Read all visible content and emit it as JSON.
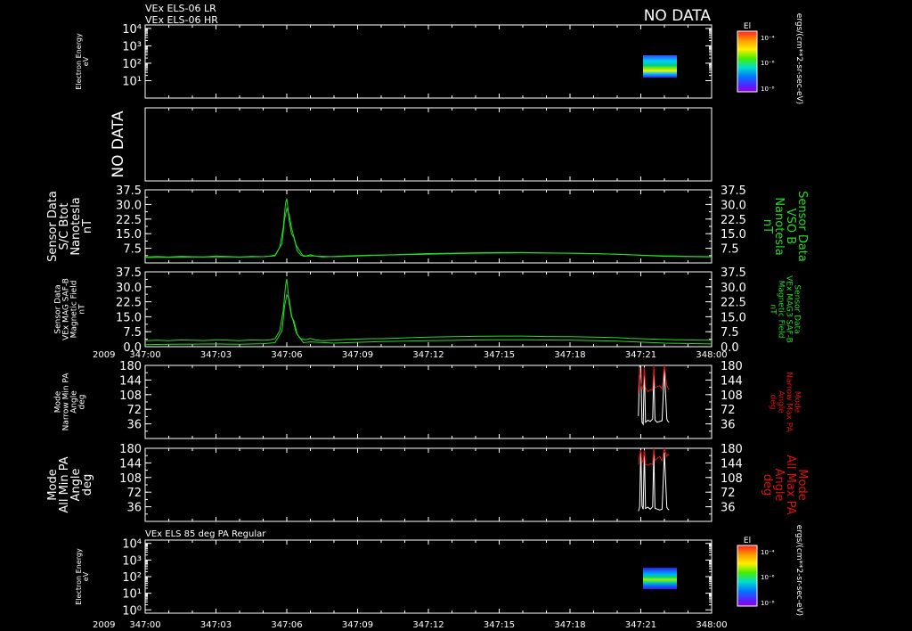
{
  "header": {
    "line1": "VEx ELS-06 LR",
    "line2": "VEx ELS-06 HR",
    "no_data": "NO DATA"
  },
  "panel7_title": "VEx ELS 85 deg PA Regular",
  "colors": {
    "background": "#000000",
    "axes": "#ffffff",
    "green": "#22dd22",
    "red": "#dd1111",
    "white": "#ffffff"
  },
  "colorbars": [
    {
      "title": "El",
      "units": "ergs/(cm**2-sr-sec-eV)",
      "tick_labels": [
        "10⁻⁴",
        "10⁻⁶",
        "10⁻⁸"
      ]
    },
    {
      "title": "El",
      "units": "ergs/(cm**2-sr-sec-eV)",
      "tick_labels": [
        "10⁻⁴",
        "10⁻⁶",
        "10⁻⁸"
      ]
    }
  ],
  "x_axis": {
    "year": "2009",
    "tick_labels": [
      "347:00",
      "347:03",
      "347:06",
      "347:09",
      "347:12",
      "347:15",
      "347:18",
      "347:21",
      "348:00"
    ],
    "domain_minutes": [
      0,
      24
    ]
  },
  "chart_data": [
    {
      "type": "heatmap",
      "ylabel": "Electron Energy\neV",
      "y_tick_labels": [
        "10⁴",
        "10³",
        "10²",
        "10¹"
      ],
      "ylim_log": [
        0,
        4.2
      ],
      "data_x_range_minutes": [
        20.9,
        22.2
      ],
      "data_energy_range_log": [
        1.0,
        2.4
      ]
    },
    {
      "type": "table",
      "ylabel": "NO DATA"
    },
    {
      "type": "line",
      "ylabel": "Sensor Data\nS/C Btot\nNanotesla\nnT",
      "right_label": "Sensor Data\nVSO B\nNanotesla\nnT",
      "y_tick_labels": [
        "37.5",
        "30.0",
        "22.5",
        "15.0",
        "7.5"
      ],
      "ylim": [
        0,
        37.5
      ],
      "series": [
        {
          "color": "green",
          "x": [
            0,
            0.5,
            1,
            1.5,
            2,
            2.5,
            3,
            3.5,
            4,
            4.5,
            5,
            5.3,
            5.5,
            5.7,
            5.85,
            5.95,
            6.0,
            6.05,
            6.1,
            6.2,
            6.3,
            6.45,
            6.6,
            6.8,
            7.0,
            7.2,
            7.5,
            8,
            8.5,
            9,
            9.5,
            10,
            11,
            12,
            13,
            14,
            15,
            16,
            17,
            18,
            19,
            20,
            20.5,
            21,
            21.5,
            22,
            22.5,
            23,
            23.5,
            24
          ],
          "y": [
            3,
            3.3,
            3,
            3.4,
            3.2,
            3.1,
            3.5,
            3.3,
            3,
            3.4,
            3.2,
            3.5,
            4,
            8,
            18,
            31,
            33,
            28,
            22,
            15,
            13,
            6,
            4,
            3.5,
            4.2,
            3.5,
            3,
            3.3,
            3.6,
            3.8,
            4,
            4,
            4.4,
            4.8,
            5,
            5.2,
            5.3,
            5.3,
            5.1,
            5,
            4.8,
            4.5,
            4.2,
            4,
            3.8,
            3.6,
            3.5,
            3.4,
            3.3,
            3.2
          ]
        },
        {
          "color": "green",
          "x": [
            0,
            1,
            2,
            3,
            4,
            5,
            5.5,
            5.8,
            5.9,
            6.0,
            6.1,
            6.2,
            6.4,
            6.7,
            7,
            8,
            9,
            10,
            12,
            14,
            16,
            18,
            20,
            22,
            24
          ],
          "y": [
            2.8,
            2.9,
            3,
            3.1,
            3,
            3.2,
            3.6,
            10,
            22,
            28,
            25,
            18,
            9,
            3.4,
            3.6,
            3.2,
            3.5,
            4,
            4.5,
            5,
            5.1,
            5,
            4.5,
            3.4,
            3.1
          ]
        }
      ]
    },
    {
      "type": "line",
      "ylabel": "Sensor Data\nVEx MAG SAF-B\nMagnetic Field\nnT",
      "right_label": "Sensor Data\nVEx MAG3 SAF-B\nMagnetic Field\nnT",
      "y_tick_labels": [
        "37.5",
        "30.0",
        "22.5",
        "15.0",
        "7.5",
        "0.0"
      ],
      "ylim": [
        0,
        37.5
      ],
      "series": [
        {
          "color": "green",
          "x": [
            0,
            0.5,
            1,
            1.5,
            2,
            2.5,
            3,
            3.5,
            4,
            4.5,
            5,
            5.3,
            5.5,
            5.7,
            5.85,
            5.95,
            6.0,
            6.05,
            6.1,
            6.2,
            6.3,
            6.45,
            6.6,
            6.8,
            7.0,
            7.2,
            7.5,
            8,
            8.5,
            9,
            9.5,
            10,
            11,
            12,
            13,
            14,
            15,
            16,
            17,
            18,
            19,
            20,
            20.5,
            21,
            21.5,
            22,
            22.5,
            23,
            23.5,
            24
          ],
          "y": [
            3,
            3.3,
            3,
            3.4,
            3.2,
            3.1,
            3.5,
            3.3,
            3,
            3.4,
            3.2,
            3.5,
            4,
            8,
            18,
            31,
            34,
            28,
            22,
            15,
            13,
            6,
            4,
            3.5,
            4.2,
            3.5,
            3,
            3.3,
            3.6,
            3.8,
            4,
            4,
            4.4,
            4.8,
            5,
            5.2,
            5.3,
            5.3,
            5.1,
            5,
            4.8,
            4.5,
            4.2,
            4,
            3.8,
            3.6,
            3.5,
            3.4,
            3.3,
            3.2
          ]
        },
        {
          "color": "green",
          "x": [
            0,
            1,
            2,
            3,
            4,
            5,
            5.5,
            5.8,
            5.9,
            6.0,
            6.1,
            6.2,
            6.4,
            6.7,
            7,
            8,
            9,
            10,
            12,
            14,
            16,
            18,
            20,
            22,
            24
          ],
          "y": [
            1,
            1.2,
            1.3,
            1.4,
            1.2,
            1.5,
            2,
            8,
            20,
            26,
            24,
            16,
            7,
            2,
            2.4,
            1.8,
            2.2,
            2.6,
            3,
            3.4,
            3.5,
            3.3,
            2.8,
            1.8,
            1.4
          ]
        }
      ]
    },
    {
      "type": "line",
      "ylabel": "Mode\nNarrow Min PA\nAngle\ndeg",
      "right_label": "Mode\nNarrow Max PA\nAngle\ndeg",
      "y_tick_labels": [
        "180",
        "144",
        "108",
        "72",
        "36"
      ],
      "ylim": [
        0,
        180
      ],
      "series": [
        {
          "color": "white",
          "x": [
            20.9,
            20.95,
            21.0,
            21.05,
            21.1,
            21.15,
            21.2,
            21.3,
            21.4,
            21.5,
            21.55,
            21.6,
            21.7,
            21.8,
            21.9,
            22.0,
            22.1,
            22.15,
            22.2
          ],
          "y": [
            55,
            180,
            180,
            40,
            35,
            180,
            40,
            45,
            42,
            48,
            170,
            45,
            40,
            42,
            44,
            170,
            48,
            42,
            40
          ]
        },
        {
          "color": "red",
          "x": [
            20.9,
            20.95,
            21.0,
            21.05,
            21.1,
            21.15,
            21.2,
            21.3,
            21.4,
            21.5,
            21.55,
            21.6,
            21.7,
            21.8,
            21.9,
            22.0,
            22.1,
            22.15,
            22.2
          ],
          "y": [
            110,
            175,
            140,
            120,
            130,
            175,
            125,
            115,
            120,
            118,
            180,
            125,
            128,
            130,
            122,
            180,
            130,
            125,
            120
          ]
        }
      ]
    },
    {
      "type": "line",
      "ylabel": "Mode\nAll Min PA\nAngle\ndeg",
      "right_label": "Mode\nAll Max PA\nAngle\ndeg",
      "y_tick_labels": [
        "180",
        "144",
        "108",
        "72",
        "36"
      ],
      "ylim": [
        0,
        180
      ],
      "series": [
        {
          "color": "white",
          "x": [
            20.9,
            20.95,
            21.0,
            21.05,
            21.1,
            21.15,
            21.2,
            21.3,
            21.4,
            21.5,
            21.55,
            21.6,
            21.7,
            21.8,
            21.9,
            22.0,
            22.1,
            22.15,
            22.2
          ],
          "y": [
            25,
            35,
            180,
            38,
            30,
            180,
            32,
            35,
            30,
            36,
            170,
            32,
            30,
            28,
            30,
            170,
            35,
            30,
            28
          ]
        },
        {
          "color": "red",
          "x": [
            20.9,
            20.95,
            21.0,
            21.05,
            21.1,
            21.15,
            21.2,
            21.3,
            21.4,
            21.5,
            21.55,
            21.6,
            21.7,
            21.8,
            21.9,
            22.0,
            22.1,
            22.15,
            22.2
          ],
          "y": [
            140,
            165,
            175,
            145,
            150,
            175,
            140,
            138,
            142,
            140,
            180,
            150,
            155,
            160,
            150,
            180,
            160,
            165,
            162
          ]
        }
      ]
    },
    {
      "type": "heatmap",
      "ylabel": "Electron Energy\neV",
      "y_tick_labels": [
        "10⁴",
        "10³",
        "10²",
        "10¹",
        "10⁰"
      ],
      "ylim_log": [
        -0.2,
        4.2
      ],
      "data_x_range_minutes": [
        20.9,
        22.2
      ],
      "data_energy_range_log": [
        0.7,
        2.2
      ]
    }
  ]
}
